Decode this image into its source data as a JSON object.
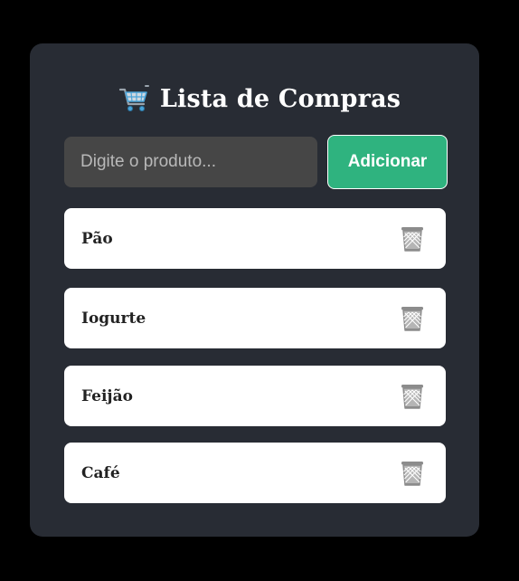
{
  "header": {
    "icon": "shopping-cart-icon",
    "title": "Lista de Compras"
  },
  "form": {
    "input_value": "",
    "input_placeholder": "Digite o produto...",
    "add_label": "Adicionar"
  },
  "items": [
    {
      "label": "Pão",
      "delete_icon": "trash-icon"
    },
    {
      "label": "Iogurte",
      "delete_icon": "trash-icon"
    },
    {
      "label": "Feijão",
      "delete_icon": "trash-icon"
    },
    {
      "label": "Café",
      "delete_icon": "trash-icon"
    }
  ],
  "colors": {
    "page_background": "#000000",
    "card_background": "#282c34",
    "input_background": "#464646",
    "accent": "#2fb37f",
    "item_background": "#ffffff"
  }
}
